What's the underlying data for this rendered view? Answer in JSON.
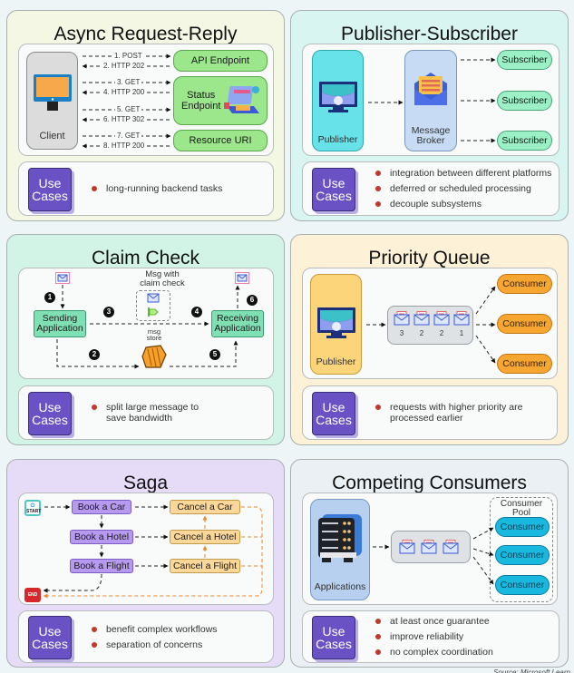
{
  "colors": {
    "async_bg": "#f3f7e4",
    "pubsub_bg": "#d9f5f1",
    "claim_bg": "#d2f4e6",
    "priority_bg": "#fdf1d8",
    "saga_bg": "#e6dcf7",
    "competing_bg": "#eaf0f3",
    "use_cases_badge": "#6a52c4",
    "bullet": "#c0392b"
  },
  "use_cases_label": [
    "Use",
    "Cases"
  ],
  "panels": {
    "async": {
      "title": "Async Request-Reply",
      "client_label": "Client",
      "endpoints": [
        "API Endpoint",
        "Status Endpoint",
        "Resource URI"
      ],
      "status_endpoint_lines": [
        "Status",
        "Endpoint"
      ],
      "messages": [
        {
          "text": "1. POST",
          "direction": "right"
        },
        {
          "text": "2. HTTP 202",
          "direction": "left"
        },
        {
          "text": "3. GET",
          "direction": "right"
        },
        {
          "text": "4. HTTP 200",
          "direction": "left"
        },
        {
          "text": "5. GET",
          "direction": "right"
        },
        {
          "text": "6. HTTP 302",
          "direction": "left"
        },
        {
          "text": "7. GET",
          "direction": "right"
        },
        {
          "text": "8. HTTP 200",
          "direction": "left"
        }
      ],
      "use_cases": [
        "long-running backend tasks"
      ]
    },
    "pubsub": {
      "title": "Publisher-Subscriber",
      "publisher_label": "Publisher",
      "broker_lines": [
        "Message",
        "Broker"
      ],
      "subscribers": [
        "Subscriber",
        "Subscriber",
        "Subscriber"
      ],
      "use_cases": [
        "integration between different platforms",
        "deferred or scheduled processing",
        "decouple subsystems"
      ]
    },
    "claim": {
      "title": "Claim Check",
      "sending_lines": [
        "Sending",
        "Application"
      ],
      "receiving_lines": [
        "Receiving",
        "Application"
      ],
      "msg_claim_lines": [
        "Msg with",
        "claim check"
      ],
      "store_lines": [
        "msg",
        "store"
      ],
      "steps": [
        "1",
        "2",
        "3",
        "4",
        "5",
        "6"
      ],
      "use_cases": [
        "split large message to save bandwidth"
      ]
    },
    "priority": {
      "title": "Priority Queue",
      "publisher_label": "Publisher",
      "queue_priorities": [
        "3",
        "2",
        "2",
        "1"
      ],
      "consumers": [
        "Consumer",
        "Consumer",
        "Consumer"
      ],
      "use_cases": [
        "requests with higher priority are processed earlier"
      ]
    },
    "saga": {
      "title": "Saga",
      "start_label": "START",
      "end_label": "END",
      "actions": [
        "Book a Car",
        "Book a Hotel",
        "Book a Flight"
      ],
      "compensations": [
        "Cancel a Car",
        "Cancel a Hotel",
        "Cancel a Flight"
      ],
      "use_cases": [
        "benefit complex workflows",
        "separation of concerns"
      ]
    },
    "competing": {
      "title": "Competing Consumers",
      "applications_label": "Applications",
      "pool_lines": [
        "Consumer",
        "Pool"
      ],
      "consumers": [
        "Consumer",
        "Consumer",
        "Consumer"
      ],
      "use_cases": [
        "at least once guarantee",
        "improve reliability",
        "no complex coordination"
      ]
    }
  },
  "source": "Source: Microsoft Learn"
}
